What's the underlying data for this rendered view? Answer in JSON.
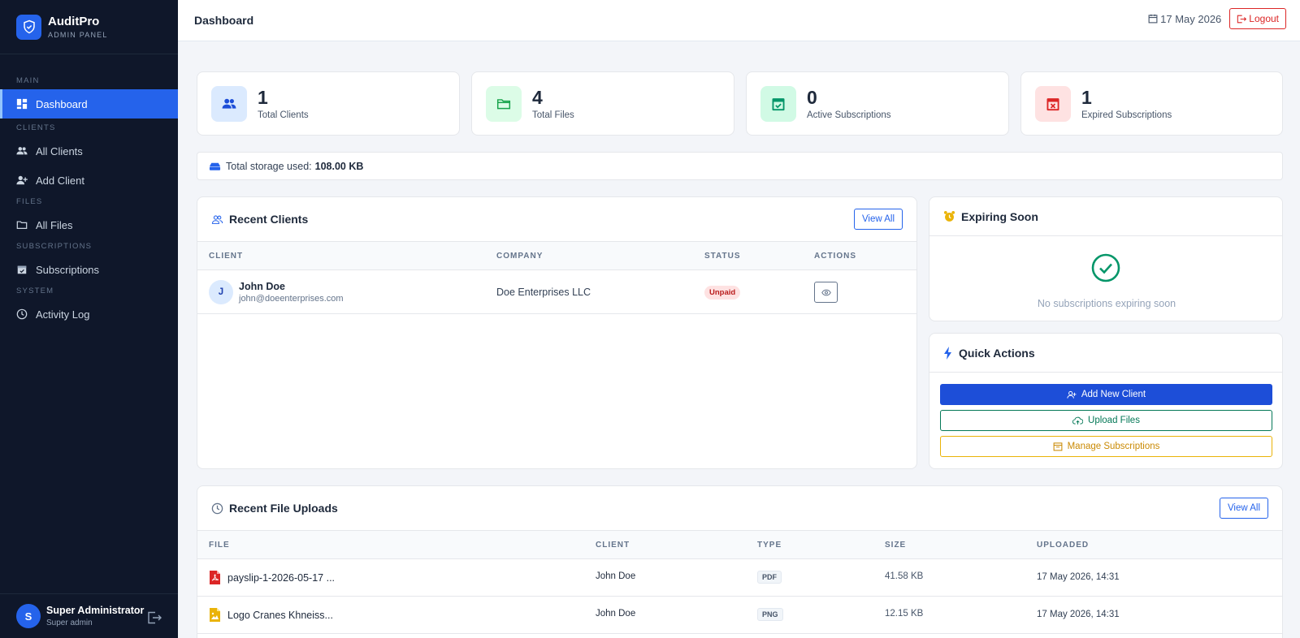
{
  "brand": {
    "name": "AuditPro",
    "subtitle": "ADMIN PANEL"
  },
  "sidebar": {
    "sections": {
      "main": "MAIN",
      "clients": "CLIENTS",
      "files": "FILES",
      "subscriptions": "SUBSCRIPTIONS",
      "system": "SYSTEM"
    },
    "items": {
      "dashboard": "Dashboard",
      "all_clients": "All Clients",
      "add_client": "Add Client",
      "all_files": "All Files",
      "subscriptions": "Subscriptions",
      "activity_log": "Activity Log"
    },
    "user": {
      "initial": "S",
      "name": "Super Administrator",
      "role": "Super admin"
    }
  },
  "topbar": {
    "title": "Dashboard",
    "date": "17 May 2026",
    "logout": "Logout"
  },
  "stats": [
    {
      "value": "1",
      "label": "Total Clients",
      "icon": "users-icon"
    },
    {
      "value": "4",
      "label": "Total Files",
      "icon": "folder-icon"
    },
    {
      "value": "0",
      "label": "Active Subscriptions",
      "icon": "calendar-check-icon"
    },
    {
      "value": "1",
      "label": "Expired Subscriptions",
      "icon": "calendar-x-icon"
    }
  ],
  "storage": {
    "label": "Total storage used:",
    "value": "108.00 KB"
  },
  "recent_clients": {
    "title": "Recent Clients",
    "view_all": "View All",
    "columns": [
      "CLIENT",
      "COMPANY",
      "STATUS",
      "ACTIONS"
    ],
    "rows": [
      {
        "initial": "J",
        "name": "John Doe",
        "email": "john@doeenterprises.com",
        "company": "Doe Enterprises LLC",
        "status": "Unpaid"
      }
    ]
  },
  "expiring": {
    "title": "Expiring Soon",
    "empty": "No subscriptions expiring soon"
  },
  "quick_actions": {
    "title": "Quick Actions",
    "add_client": "Add New Client",
    "upload_files": "Upload Files",
    "manage_subscriptions": "Manage Subscriptions"
  },
  "recent_files": {
    "title": "Recent File Uploads",
    "view_all": "View All",
    "columns": [
      "FILE",
      "CLIENT",
      "TYPE",
      "SIZE",
      "UPLOADED"
    ],
    "rows": [
      {
        "name": "payslip-1-2026-05-17 ...",
        "client": "John Doe",
        "type": "PDF",
        "size": "41.58 KB",
        "uploaded": "17 May 2026, 14:31",
        "icon": "pdf-file-icon"
      },
      {
        "name": "Logo Cranes Khneiss...",
        "client": "John Doe",
        "type": "PNG",
        "size": "12.15 KB",
        "uploaded": "17 May 2026, 14:31",
        "icon": "image-file-icon"
      }
    ]
  },
  "colors": {
    "primary": "#2563eb",
    "sidebar": "#0f172a",
    "danger": "#dc2626",
    "success": "#059669",
    "warning": "#eab308"
  }
}
